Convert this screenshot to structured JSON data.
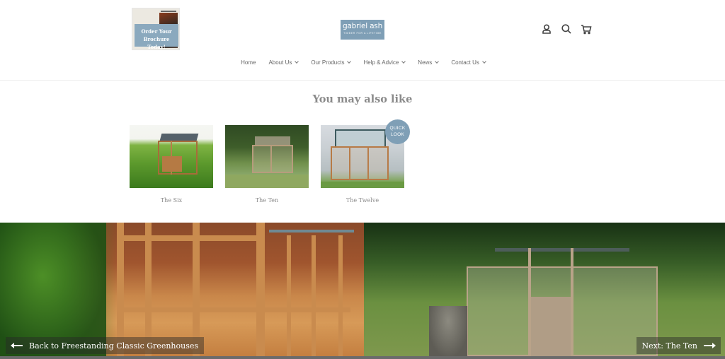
{
  "header": {
    "brochure_banner": {
      "line1": "Order Your",
      "line2": "Brochure Today!"
    },
    "logo": {
      "name": "gabriel ash",
      "tagline": "TIMBER FOR A LIFETIME"
    },
    "icons": [
      {
        "name": "account-icon"
      },
      {
        "name": "search-icon"
      },
      {
        "name": "cart-icon"
      }
    ]
  },
  "nav": {
    "items": [
      {
        "label": "Home",
        "has_dropdown": false
      },
      {
        "label": "About Us",
        "has_dropdown": true
      },
      {
        "label": "Our Products",
        "has_dropdown": true
      },
      {
        "label": "Help & Advice",
        "has_dropdown": true
      },
      {
        "label": "News",
        "has_dropdown": true
      },
      {
        "label": "Contact Us",
        "has_dropdown": true
      }
    ]
  },
  "recommendations": {
    "title": "You may also like",
    "products": [
      {
        "name": "The Six"
      },
      {
        "name": "The Ten"
      },
      {
        "name": "The Twelve",
        "badge": "QUICK LOOK"
      }
    ]
  },
  "hero": {
    "back_link": "Back to Freestanding Classic Greenhouses",
    "next_link": "Next: The Ten"
  },
  "colors": {
    "brand_blue": "#7f9fb6",
    "text_grey": "#8a8a8a"
  }
}
